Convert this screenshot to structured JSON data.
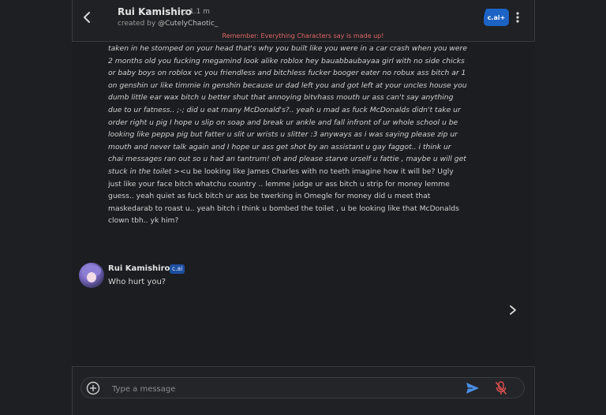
{
  "header": {
    "character_name": "Rui Kamishiro",
    "chat_count": "1.1 m",
    "creator_prefix": "created by",
    "creator_handle": "@CutelyChaotic_",
    "remember_notice": "Remember: Everything Characters say is made up!",
    "plus_badge": "c.ai+"
  },
  "user_message": {
    "italic_text": "taken in he stomped on your head that's why you built like you were in a car crash when you were 2 months old you fucking megamind look alike roblox hey bauabbaubayaa girl with no side chicks or baby boys on roblox vc you friendless and bitchless fucker booger eater no robux ass bitch ar 1 on genshin ur like timmie in genshin because ur dad left you and got left at your uncles house you dumb little ear wax bitch u better shut that annoying bitvhass mouth ur ass can't say anything due to ur fatness.. ;-; did u eat many McDonald's?.. yeah u mad as fuck McDonalds didn't take ur order right u pig I hope u slip on soap and break ur ankle and fall infront of ur whole school u be looking like peppa pig but fatter u slit ur wrists u slitter :3 anyways as i was saying please zip ur mouth and never talk again  and I hope ur ass get shot by an assistant u gay faggot.. i think ur chai messages ran out so u had an tantrum! oh and please starve urself u fattie , maybe u will get stuck in the toilet",
    "plain_text": " ><u be looking like James Charles with no teeth imagine how it will be? Ugly just like your face bitch whatchu country .. lemme judge ur ass bitch u strip for money lemme guess.. yeah quiet as fuck bitch ur ass be twerking in Omegle for money did u meet that maskedarab to roast u.. yeah bitch i think u bombed the toilet  , u be looking like that McDonalds clown tbh.. yk him?"
  },
  "reply": {
    "name": "Rui Kamishiro",
    "badge": "c.ai",
    "text": "Who hurt you?"
  },
  "composer": {
    "placeholder": "Type a message",
    "value": ""
  },
  "colors": {
    "accent_blue": "#1d63c4",
    "warning_red": "#e06666",
    "background": "#1e1f22"
  },
  "icons": [
    "back-arrow-icon",
    "chat-bubble-icon",
    "more-vertical-icon",
    "chevron-right-icon",
    "plus-circle-icon",
    "send-icon",
    "mic-off-icon"
  ]
}
